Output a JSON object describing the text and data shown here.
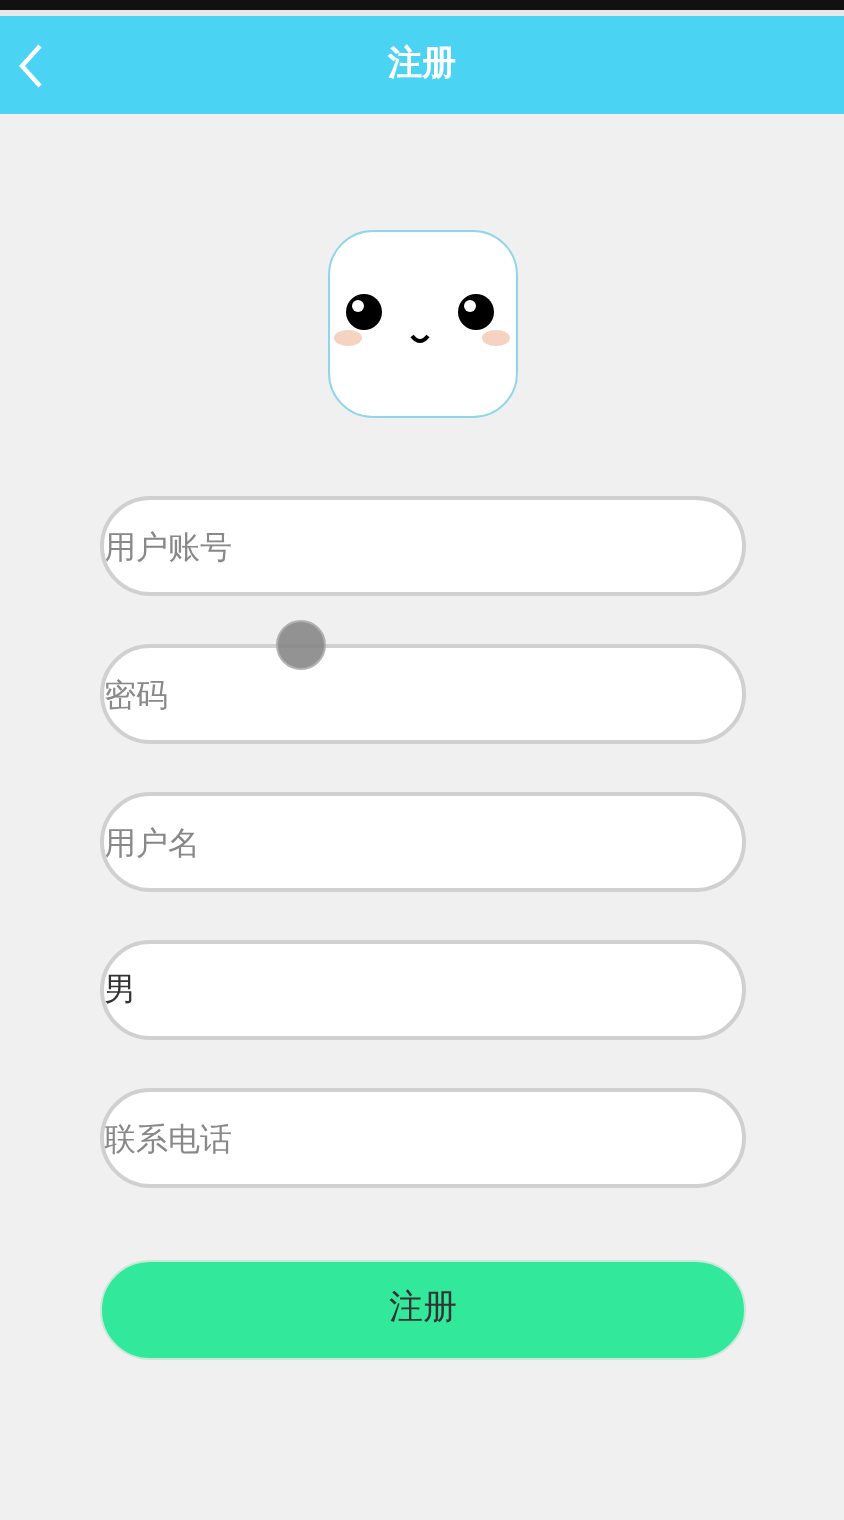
{
  "header": {
    "title": "注册"
  },
  "fields": [
    {
      "placeholder": "用户账号"
    },
    {
      "placeholder": "密码"
    },
    {
      "placeholder": "用户名"
    },
    {
      "value": "男"
    },
    {
      "placeholder": "联系电话"
    }
  ],
  "submit": {
    "label": "注册"
  }
}
